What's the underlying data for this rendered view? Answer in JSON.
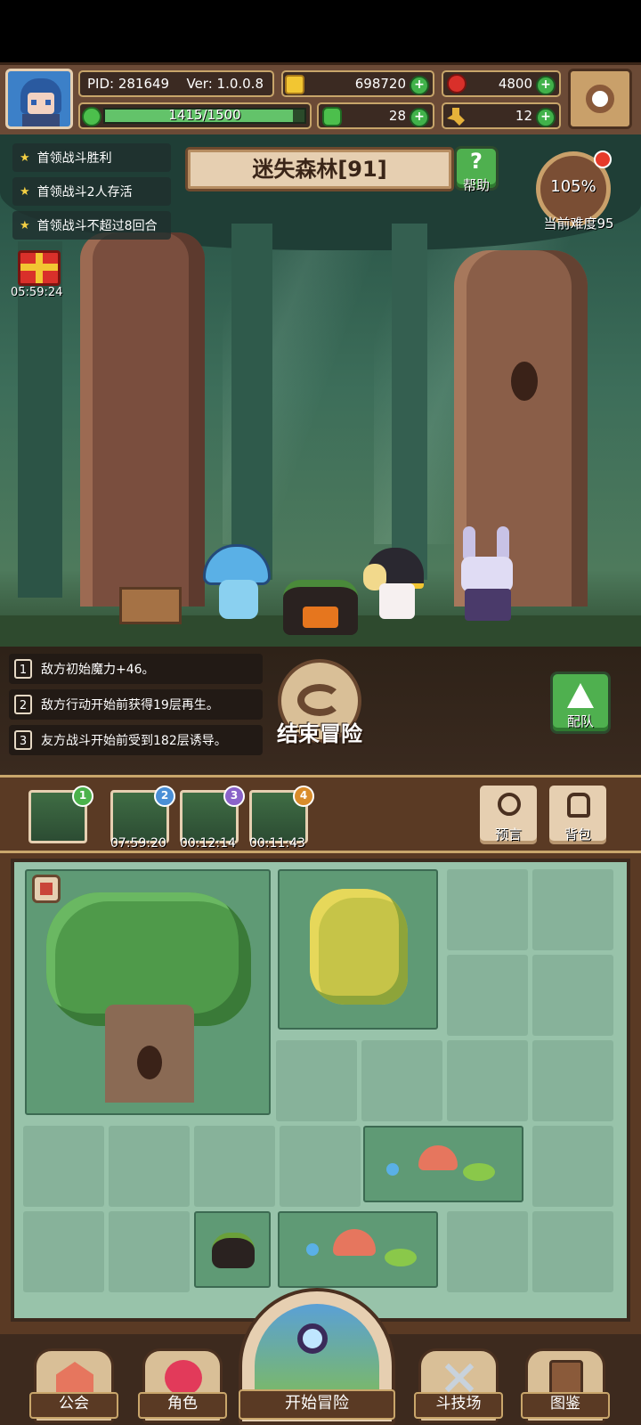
{
  "header": {
    "pid": "PID: 281649",
    "version": "Ver: 1.0.0.8",
    "gold": "698720",
    "gems": "4800",
    "stamina": "1415/1500",
    "clover": "28",
    "keys": "12"
  },
  "quests": [
    "首领战斗胜利",
    "首领战斗2人存活",
    "首领战斗不超过8回合"
  ],
  "gift_timer": "05:59:24",
  "stage": {
    "title": "迷失森林[91]",
    "help_label": "帮助",
    "difficulty_percent": "105%",
    "difficulty_label": "当前难度95"
  },
  "effects": [
    {
      "num": "1",
      "text": "敌方初始魔力+46。"
    },
    {
      "num": "2",
      "text": "敌方行动开始前获得19层再生。"
    },
    {
      "num": "3",
      "text": "友方战斗开始前受到182层诱导。"
    }
  ],
  "end_adventure_label": "结束冒险",
  "team_label": "配队",
  "maps": [
    {
      "badge": "1",
      "color": "#4bb24b",
      "timer": ""
    },
    {
      "badge": "2",
      "color": "#4a8fd6",
      "timer": "07:59:20"
    },
    {
      "badge": "3",
      "color": "#8a63c9",
      "timer": "00:12:14"
    },
    {
      "badge": "4",
      "color": "#d98c2b",
      "timer": "00:11:43"
    }
  ],
  "prophecy_label": "预言",
  "bag_label": "背包",
  "nav": {
    "guild": "公会",
    "character": "角色",
    "start_adventure": "开始冒险",
    "arena": "斗技场",
    "codex": "图鉴"
  }
}
